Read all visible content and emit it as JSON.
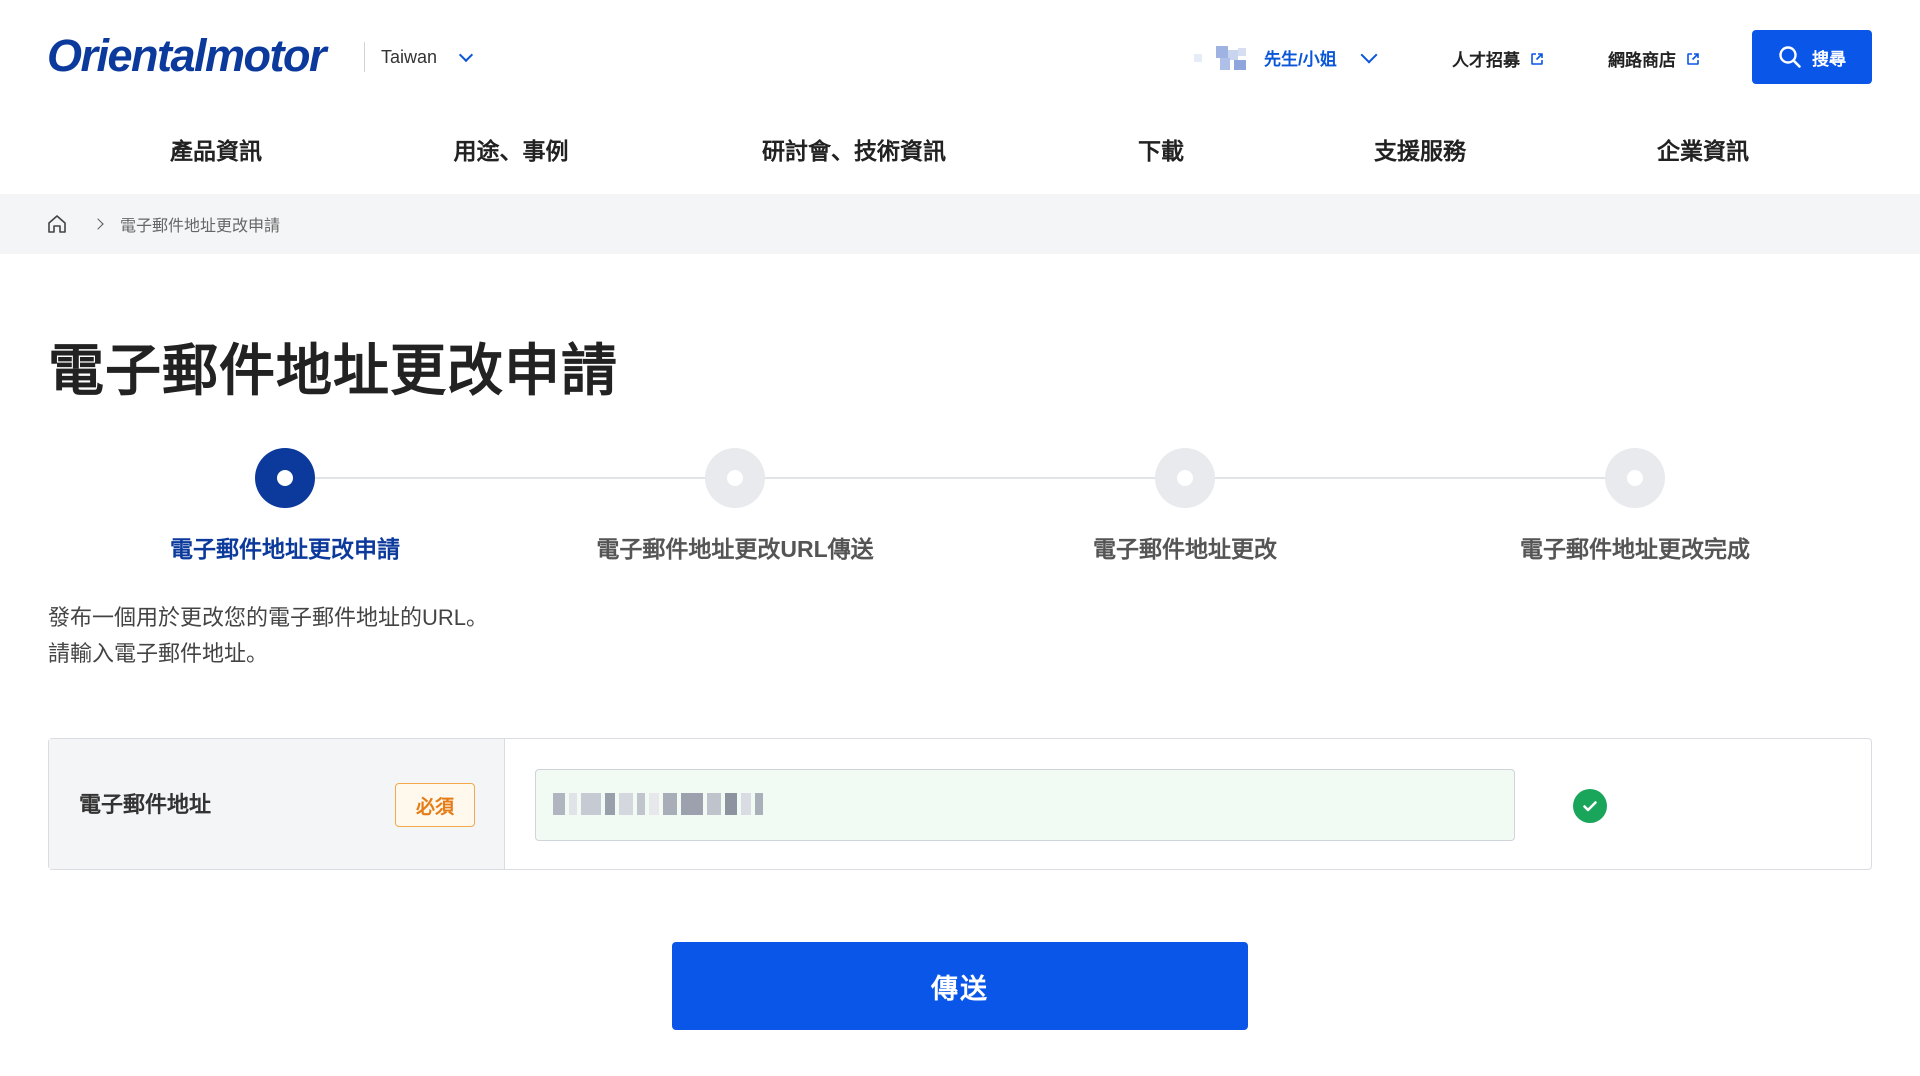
{
  "header": {
    "logo": "Orientalmotor",
    "region_label": "Taiwan",
    "user_name": "先生/小姐",
    "recruit_link": "人才招募",
    "shop_link": "網路商店",
    "search_label": "搜尋"
  },
  "nav": {
    "items": [
      {
        "label": "產品資訊"
      },
      {
        "label": "用途、事例"
      },
      {
        "label": "研討會、技術資訊"
      },
      {
        "label": "下載"
      },
      {
        "label": "支援服務"
      },
      {
        "label": "企業資訊"
      }
    ]
  },
  "breadcrumb": {
    "current": "電子郵件地址更改申請"
  },
  "page": {
    "title": "電子郵件地址更改申請",
    "desc_line1": "發布一個用於更改您的電子郵件地址的URL。",
    "desc_line2": "請輸入電子郵件地址。"
  },
  "stepper": {
    "active_index": 0,
    "steps": [
      {
        "label": "電子郵件地址更改申請"
      },
      {
        "label": "電子郵件地址更改URL傳送"
      },
      {
        "label": "電子郵件地址更改"
      },
      {
        "label": "電子郵件地址更改完成"
      }
    ]
  },
  "form": {
    "email_label": "電子郵件地址",
    "required_badge": "必須"
  },
  "submit_label": "傳送",
  "colors": {
    "brand_blue": "#0a56e8",
    "navy": "#0b3a9c",
    "success_green": "#1aa65a",
    "required_orange": "#e57c16"
  }
}
